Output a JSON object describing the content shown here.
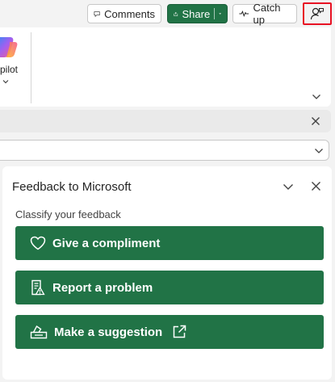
{
  "toolbar": {
    "comments_label": "Comments",
    "share_label": "Share",
    "catchup_label": "Catch up",
    "profile_icon": "person-feedback-icon"
  },
  "ribbon": {
    "copilot_label": "pilot"
  },
  "feedback_pane": {
    "title": "Feedback to Microsoft",
    "subtitle": "Classify your feedback",
    "buttons": [
      {
        "label": "Give a compliment",
        "icon": "heart-icon"
      },
      {
        "label": "Report a problem",
        "icon": "report-icon"
      },
      {
        "label": "Make a suggestion",
        "icon": "suggestion-icon"
      }
    ]
  },
  "colors": {
    "accent_green": "#217346",
    "highlight_red": "#e81123"
  }
}
